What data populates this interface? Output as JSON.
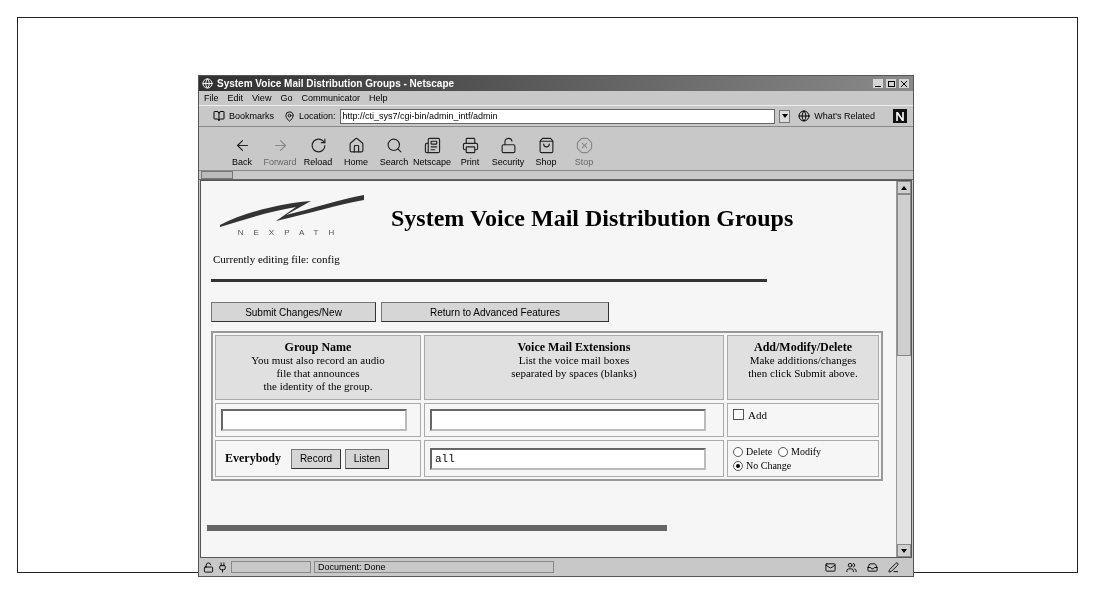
{
  "window": {
    "title": "System Voice Mail Distribution Groups - Netscape"
  },
  "menu": [
    "File",
    "Edit",
    "View",
    "Go",
    "Communicator",
    "Help"
  ],
  "location_bar": {
    "bookmarks": "Bookmarks",
    "location_label": "Location:",
    "url": "http://cti_sys7/cgi-bin/admin_intf/admin",
    "whats_related": "What's Related"
  },
  "toolbar": [
    {
      "kind": "back",
      "label": "Back",
      "disabled": false
    },
    {
      "kind": "forward",
      "label": "Forward",
      "disabled": true
    },
    {
      "kind": "reload",
      "label": "Reload",
      "disabled": false
    },
    {
      "kind": "home",
      "label": "Home",
      "disabled": false
    },
    {
      "kind": "search",
      "label": "Search",
      "disabled": false
    },
    {
      "kind": "netscape",
      "label": "Netscape",
      "disabled": false
    },
    {
      "kind": "print",
      "label": "Print",
      "disabled": false
    },
    {
      "kind": "security",
      "label": "Security",
      "disabled": false
    },
    {
      "kind": "shop",
      "label": "Shop",
      "disabled": false
    },
    {
      "kind": "stop",
      "label": "Stop",
      "disabled": true
    }
  ],
  "page": {
    "logo": "NEXPATH",
    "heading": "System Voice Mail Distribution Groups",
    "editing_note": "Currently editing file: config",
    "buttons": [
      "Submit Changes/New",
      "Return to Advanced Features"
    ],
    "table": {
      "columns": [
        {
          "title": "Group Name",
          "description": [
            "You must also record an audio",
            "file that announces",
            "the identity of the group."
          ]
        },
        {
          "title": "Voice Mail Extensions",
          "description": [
            "List the voice mail boxes",
            "separated by spaces (blanks)"
          ]
        },
        {
          "title": "Add/Modify/Delete",
          "description": [
            "Make additions/changes",
            "then click Submit above."
          ]
        }
      ],
      "new_row": {
        "add": {
          "label": "Add",
          "checked": false
        }
      },
      "rows": [
        {
          "name": "Everybody",
          "buttons": [
            "Record",
            "Listen"
          ],
          "extensions": "all",
          "actions": [
            {
              "label": "Delete",
              "selected": false
            },
            {
              "label": "Modify",
              "selected": false
            },
            {
              "label": "No Change",
              "selected": true
            }
          ]
        }
      ]
    }
  },
  "status_bar": {
    "text": "Document: Done"
  }
}
